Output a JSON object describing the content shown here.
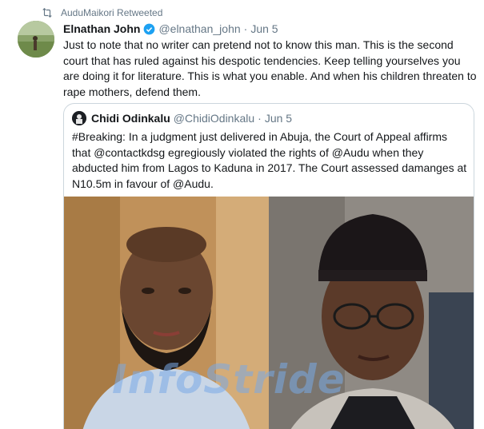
{
  "retweet": {
    "label": "AuduMaikori Retweeted"
  },
  "tweet": {
    "display_name": "Elnathan John",
    "handle": "@elnathan_john",
    "separator": "·",
    "date": "Jun 5",
    "text": "Just to note that no writer can pretend not to know this man. This is the second court that has ruled against his despotic tendencies. Keep telling yourselves you are doing it for literature. This is what you enable. And when his children threaten to rape mothers, defend them."
  },
  "quote": {
    "display_name": "Chidi Odinkalu",
    "handle": "@ChidiOdinkalu",
    "separator": "·",
    "date": "Jun 5",
    "text": "#Breaking: In a judgment just delivered in Abuja, the Court of Appeal affirms that @contactkdsg egregiously violated the rights of @Audu when they abducted him from Lagos to Kaduna in 2017. The Court assessed damanges at N10.5m in favour of @Audu.",
    "watermark": "InfoStride"
  },
  "colors": {
    "verified": "#1da1f2",
    "muted": "#657786",
    "text": "#14171a",
    "border": "#ccd6dd"
  },
  "icons": {
    "retweet": "retweet-icon",
    "verified": "verified-badge-icon"
  }
}
